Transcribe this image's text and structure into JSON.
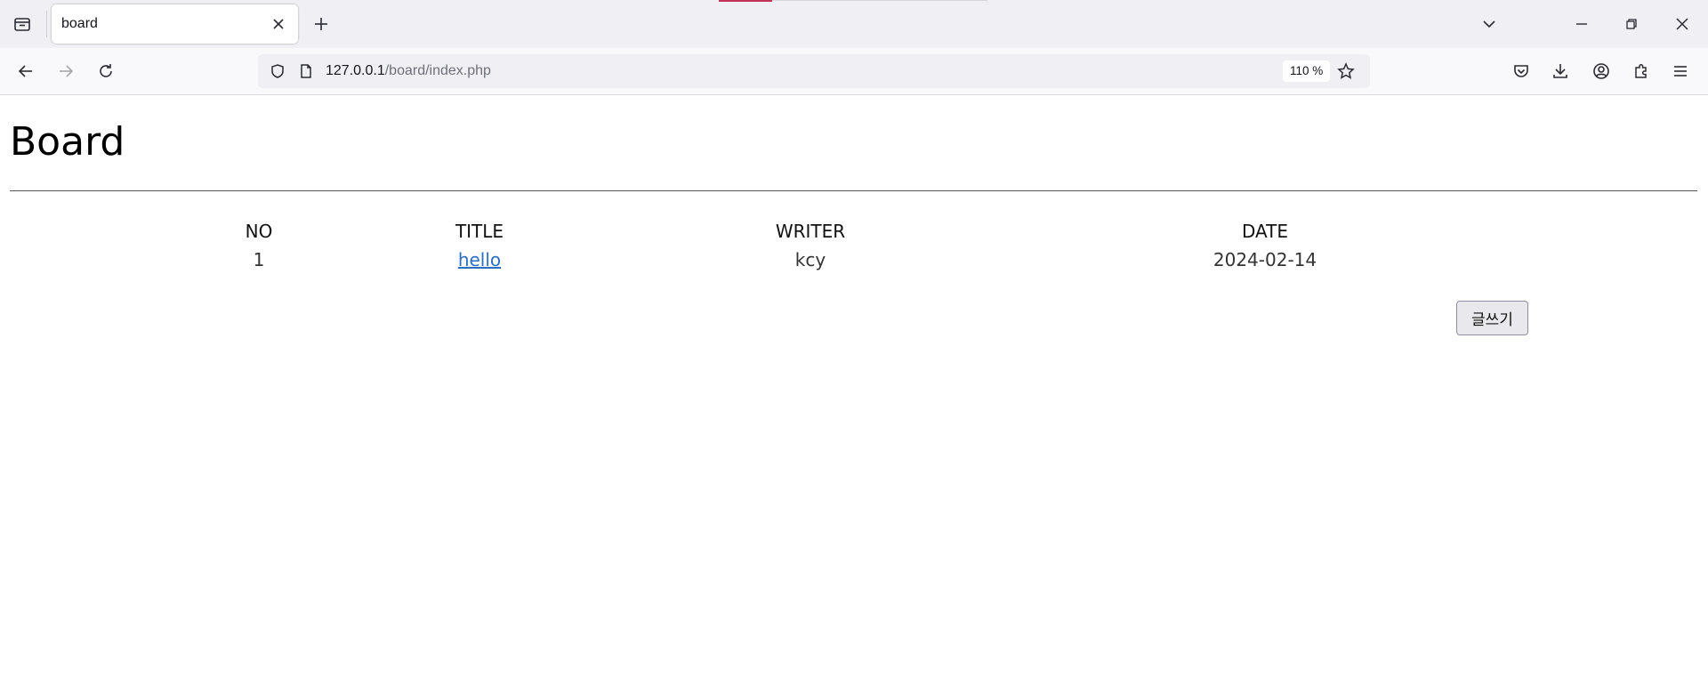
{
  "browser": {
    "tab": {
      "title": "board"
    },
    "url": {
      "host": "127.0.0.1",
      "path": "/board/index.php"
    },
    "zoom": "110 %"
  },
  "page": {
    "title": "Board",
    "table": {
      "headers": {
        "no": "NO",
        "title": "TITLE",
        "writer": "WRITER",
        "date": "DATE"
      },
      "rows": [
        {
          "no": "1",
          "title": "hello",
          "writer": "kcy",
          "date": "2024-02-14"
        }
      ]
    },
    "write_button": "글쓰기"
  },
  "colors": {
    "link": "#2a6fc4",
    "tab_accent": "#c0345a"
  }
}
